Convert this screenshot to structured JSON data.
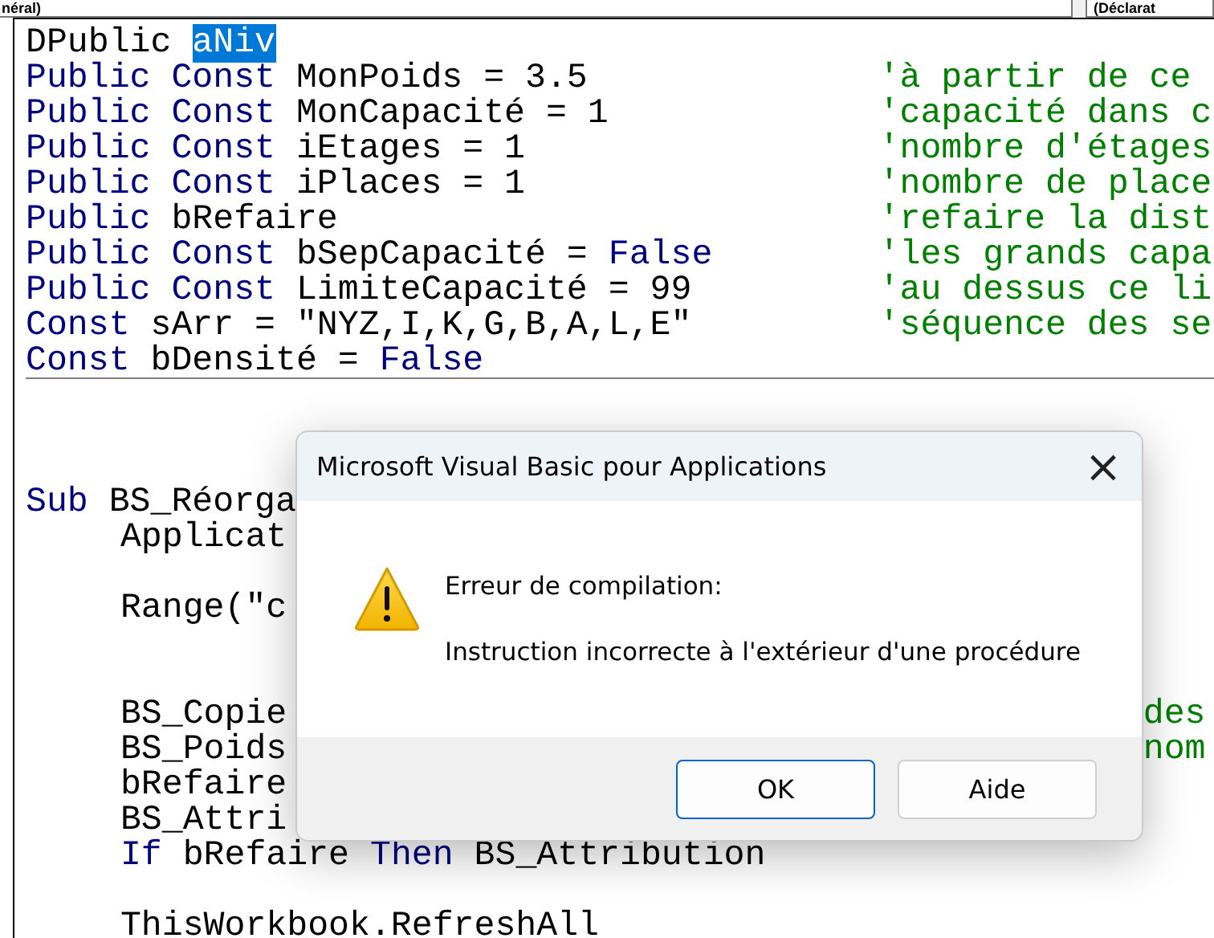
{
  "toolbar": {
    "object_combo": "néral)",
    "procedure_combo": "(Déclarat"
  },
  "code_lines": [
    {
      "code": [
        {
          "kind": "plain",
          "text": "DPublic "
        },
        {
          "kind": "selected",
          "text": "aNiv"
        }
      ]
    },
    {
      "code": [
        {
          "kind": "keyword",
          "text": "Public Const "
        },
        {
          "kind": "plain",
          "text": "MonPoids = 3.5"
        }
      ],
      "comment": "'à partir de ce"
    },
    {
      "code": [
        {
          "kind": "keyword",
          "text": "Public Const "
        },
        {
          "kind": "plain",
          "text": "MonCapacité = 1"
        }
      ],
      "comment": "'capacité dans c"
    },
    {
      "code": [
        {
          "kind": "keyword",
          "text": "Public Const "
        },
        {
          "kind": "plain",
          "text": "iEtages = 1"
        }
      ],
      "comment": "'nombre d'étages"
    },
    {
      "code": [
        {
          "kind": "keyword",
          "text": "Public Const "
        },
        {
          "kind": "plain",
          "text": "iPlaces = 1"
        }
      ],
      "comment": "'nombre de place"
    },
    {
      "code": [
        {
          "kind": "keyword",
          "text": "Public "
        },
        {
          "kind": "plain",
          "text": "bRefaire"
        }
      ],
      "comment": "'refaire la dist"
    },
    {
      "code": [
        {
          "kind": "keyword",
          "text": "Public Const "
        },
        {
          "kind": "plain",
          "text": "bSepCapacité = "
        },
        {
          "kind": "keyword",
          "text": "False"
        }
      ],
      "comment": "'les grands capa"
    },
    {
      "code": [
        {
          "kind": "keyword",
          "text": "Public Const "
        },
        {
          "kind": "plain",
          "text": "LimiteCapacité = 99"
        }
      ],
      "comment": "'au dessus ce li"
    },
    {
      "code": [
        {
          "kind": "keyword",
          "text": "Const "
        },
        {
          "kind": "plain",
          "text": "sArr = \"NYZ,I,K,G,B,A,L,E\""
        }
      ],
      "comment": "'séquence des se"
    },
    {
      "code": [
        {
          "kind": "keyword",
          "text": "Const "
        },
        {
          "kind": "plain",
          "text": "bDensité = "
        },
        {
          "kind": "keyword",
          "text": "False"
        }
      ],
      "separator": true
    },
    {
      "kind": "blank"
    },
    {
      "kind": "blank"
    },
    {
      "kind": "blank"
    },
    {
      "code": [
        {
          "kind": "keyword",
          "text": "Sub "
        },
        {
          "kind": "plain",
          "text": "BS_Réorga"
        }
      ]
    },
    {
      "indent": true,
      "code": [
        {
          "kind": "plain",
          "text": "Applicat"
        }
      ]
    },
    {
      "kind": "blank"
    },
    {
      "indent": true,
      "code": [
        {
          "kind": "plain",
          "text": "Range(\"c"
        }
      ]
    },
    {
      "kind": "blank"
    },
    {
      "kind": "blank"
    },
    {
      "indent": true,
      "code": [
        {
          "kind": "plain",
          "text": "BS_Copie"
        }
      ],
      "tail": "des"
    },
    {
      "indent": true,
      "code": [
        {
          "kind": "plain",
          "text": "BS_Poids"
        }
      ],
      "tail": "nom"
    },
    {
      "indent": true,
      "code": [
        {
          "kind": "plain",
          "text": "bRefaire"
        }
      ]
    },
    {
      "indent": true,
      "code": [
        {
          "kind": "plain",
          "text": "BS_Attri"
        }
      ]
    },
    {
      "indent": true,
      "code": [
        {
          "kind": "keyword",
          "text": "If "
        },
        {
          "kind": "plain",
          "text": "bRefaire "
        },
        {
          "kind": "keyword",
          "text": "Then "
        },
        {
          "kind": "plain",
          "text": "BS_Attribution"
        }
      ]
    },
    {
      "kind": "blank"
    },
    {
      "indent": true,
      "code": [
        {
          "kind": "plain",
          "text": "ThisWorkbook.RefreshAll"
        }
      ]
    }
  ],
  "dialog": {
    "title": "Microsoft Visual Basic pour Applications",
    "close": "×",
    "heading": "Erreur de compilation:",
    "message": "Instruction incorrecte à l'extérieur d'une procédure",
    "buttons": [
      {
        "label": "OK",
        "selected": true
      },
      {
        "label": "Aide",
        "selected": false
      }
    ]
  }
}
